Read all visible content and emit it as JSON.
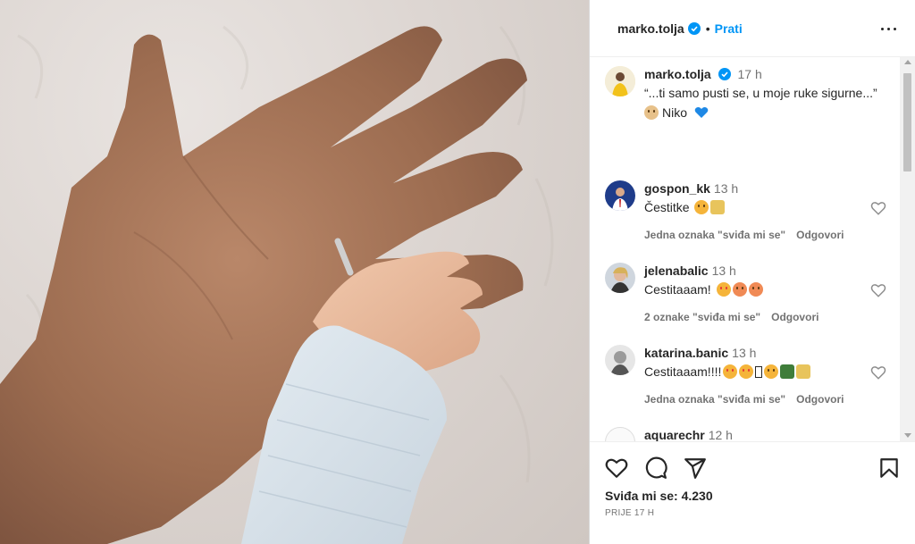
{
  "post": {
    "username": "marko.tolja",
    "follow_label": "Prati",
    "dot": "•",
    "caption_time": "17 h",
    "caption_line1": "“...ti samo pusti se, u moje ruke sigurne...”",
    "caption_line2": "Niko",
    "likes": "Sviđa mi se: 4.230",
    "posted_ago": "PRIJE 17 H"
  },
  "comments": [
    {
      "username": "gospon_kk",
      "time": "13 h",
      "text": "Čestitke",
      "likes_text": "Jedna oznaka \"sviđa mi se\"",
      "reply": "Odgovori"
    },
    {
      "username": "jelenabalic",
      "time": "13 h",
      "text": "Cestitaaam!",
      "likes_text": "2 oznake \"sviđa mi se\"",
      "reply": "Odgovori"
    },
    {
      "username": "katarina.banic",
      "time": "13 h",
      "text": "Cestitaaam!!!!",
      "likes_text": "Jedna oznaka \"sviđa mi se\"",
      "reply": "Odgovori"
    },
    {
      "username": "aquarechr",
      "time": "12 h"
    }
  ],
  "icons": {
    "verified": "verified-badge-icon",
    "more": "more-options-icon",
    "like": "heart-icon",
    "comment": "comment-icon",
    "share": "share-icon",
    "save": "bookmark-icon"
  },
  "colors": {
    "accent": "#0095f6",
    "text": "#262626",
    "muted": "#737373",
    "verified": "#0095f6"
  }
}
